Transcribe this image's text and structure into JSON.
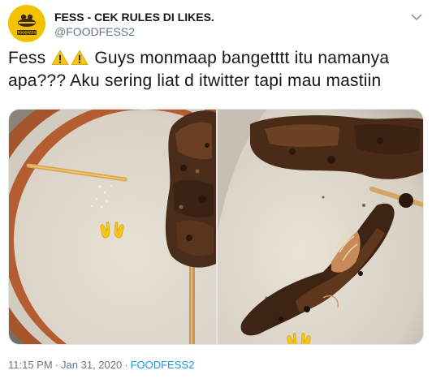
{
  "tweet": {
    "display_name": "FESS - CEK RULES DI LIKES.",
    "handle": "@FOODFESS2",
    "avatar_logo": "FOODFESS",
    "text_part1": "Fess ",
    "text_part2": " Guys monmaap bangetttt itu namanya apa??? Aku sering liat d itwitter tapi mau mastiin",
    "time": "11:15 PM",
    "date_separator": "·",
    "date": "Jan 31, 2020",
    "source_separator": "·",
    "source": "FOODFESS2"
  },
  "icons": {
    "menu": "chevron-down-icon",
    "warning": "warning-sign-emoji",
    "hands": "open-hands-emoji"
  },
  "colors": {
    "text_primary": "#14171a",
    "text_secondary": "#657786",
    "link": "#1b95e0",
    "avatar_bg": "#f2c200",
    "warning_yellow": "#f5c518"
  }
}
